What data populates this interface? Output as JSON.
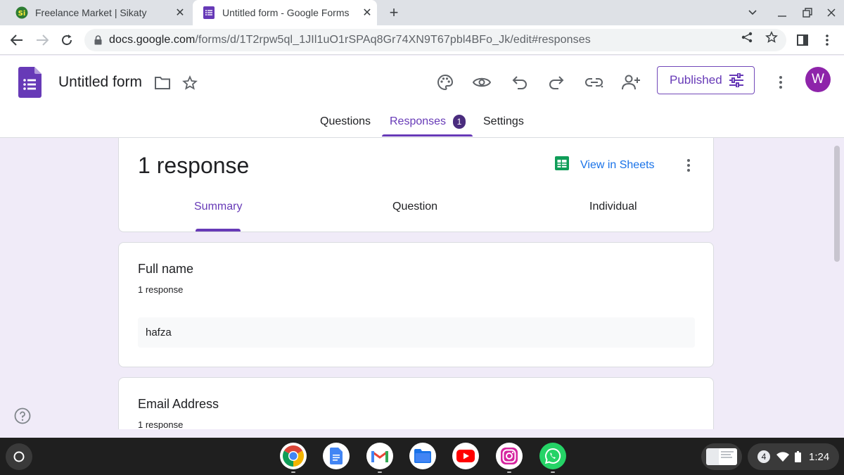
{
  "browser": {
    "tabs": [
      {
        "title": "Freelance Market | Sikaty",
        "favicon": "sikaty-icon",
        "active": false
      },
      {
        "title": "Untitled form - Google Forms",
        "favicon": "google-forms-icon",
        "active": true
      }
    ],
    "new_tab": "+",
    "url_host": "docs.google.com",
    "url_path": "/forms/d/1T2rpw5ql_1JIl1uO1rSPAq8Gr74XN9T67pbl4BFo_Jk/edit#responses"
  },
  "form": {
    "title": "Untitled form",
    "publish_label": "Published",
    "avatar_letter": "W",
    "tabs": [
      {
        "label": "Questions"
      },
      {
        "label": "Responses",
        "badge": "1"
      },
      {
        "label": "Settings"
      }
    ]
  },
  "responses": {
    "count_label": "1 response",
    "view_in_sheets": "View in Sheets",
    "subtabs": [
      {
        "label": "Summary"
      },
      {
        "label": "Question"
      },
      {
        "label": "Individual"
      }
    ],
    "questions": [
      {
        "title": "Full name",
        "count": "1 response",
        "answers": [
          "hafza"
        ]
      },
      {
        "title": "Email Address",
        "count": "1 response",
        "answers": []
      }
    ]
  },
  "shelf": {
    "apps": [
      "chrome-icon",
      "google-docs-icon",
      "gmail-icon",
      "files-icon",
      "youtube-icon",
      "instagram-icon",
      "whatsapp-icon"
    ],
    "notification_count": "4",
    "time": "1:24"
  },
  "colors": {
    "forms_purple": "#673ab7",
    "page_bg": "#f0ebf8",
    "link_blue": "#1a73e8",
    "avatar": "#8e24aa"
  }
}
